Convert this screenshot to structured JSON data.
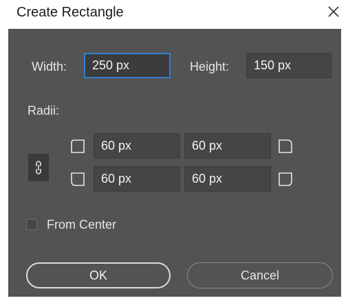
{
  "window": {
    "title": "Create Rectangle"
  },
  "size": {
    "width_label": "Width:",
    "width_value": "250 px",
    "height_label": "Height:",
    "height_value": "150 px"
  },
  "radii": {
    "label": "Radii:",
    "top_left": "60 px",
    "top_right": "60 px",
    "bottom_left": "60 px",
    "bottom_right": "60 px"
  },
  "options": {
    "from_center_label": "From Center",
    "from_center_checked": false
  },
  "buttons": {
    "ok_label": "OK",
    "cancel_label": "Cancel"
  },
  "colors": {
    "panel": "#535353",
    "field": "#454545",
    "focus": "#2f7fd2"
  }
}
